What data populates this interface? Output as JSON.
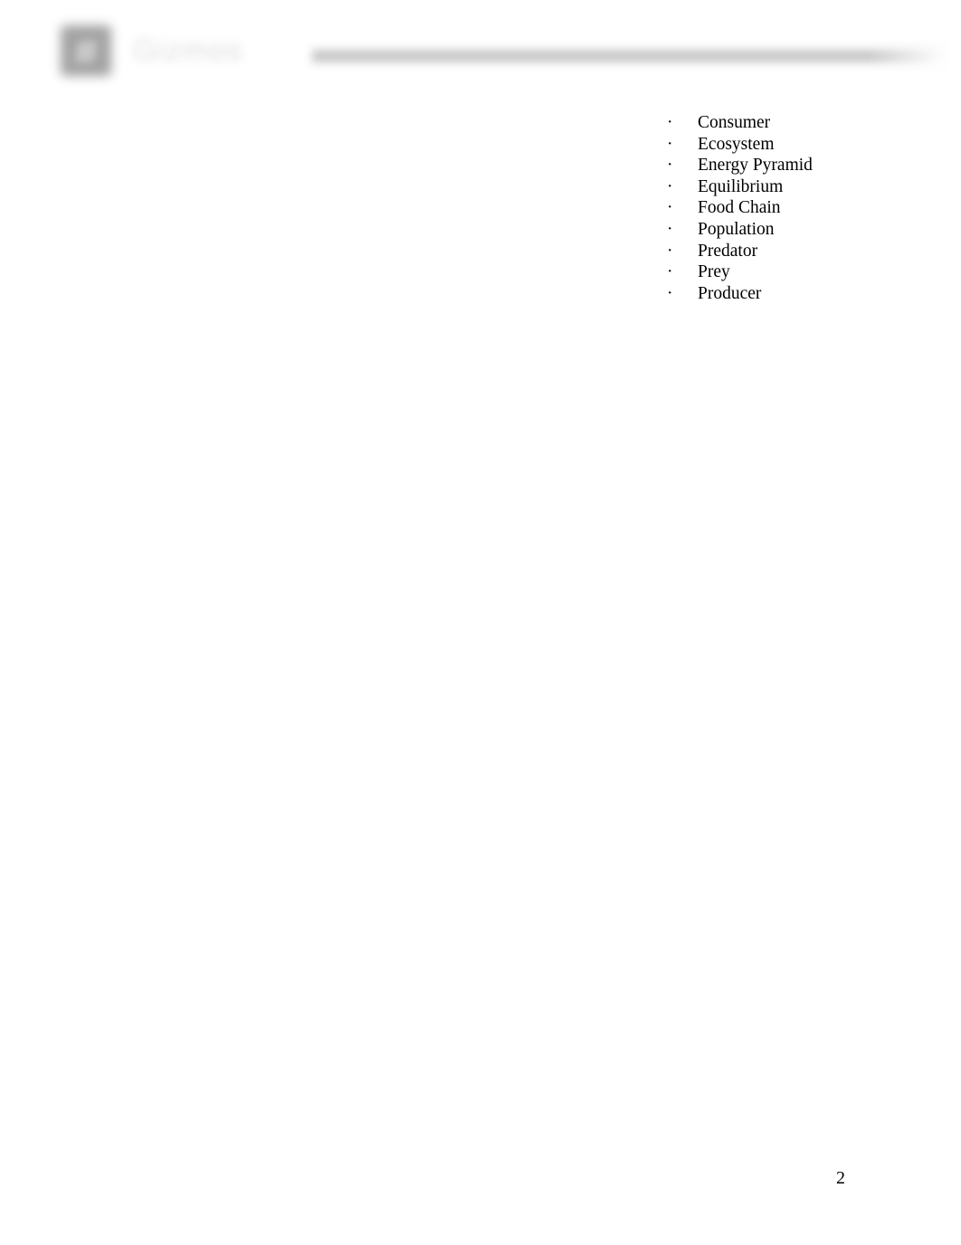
{
  "document": {
    "page_number": "2"
  },
  "header": {
    "logo_icon": "document-logo-icon",
    "wordmark": "Gizmos",
    "rule": "header-divider-rule"
  },
  "body": {
    "vocabulary_list": {
      "bullet_char": "·",
      "items": [
        {
          "label": "Consumer"
        },
        {
          "label": "Ecosystem"
        },
        {
          "label": "Energy Pyramid"
        },
        {
          "label": "Equilibrium"
        },
        {
          "label": "Food Chain"
        },
        {
          "label": "Population"
        },
        {
          "label": "Predator"
        },
        {
          "label": "Prey"
        },
        {
          "label": "Producer"
        }
      ]
    }
  },
  "colors": {
    "page_background": "#ffffff",
    "text": "#000000",
    "logo_gray": "#9b9b9b",
    "rule_gray": "#c4c4c4",
    "wordmark_gray": "#dcdcdc"
  }
}
